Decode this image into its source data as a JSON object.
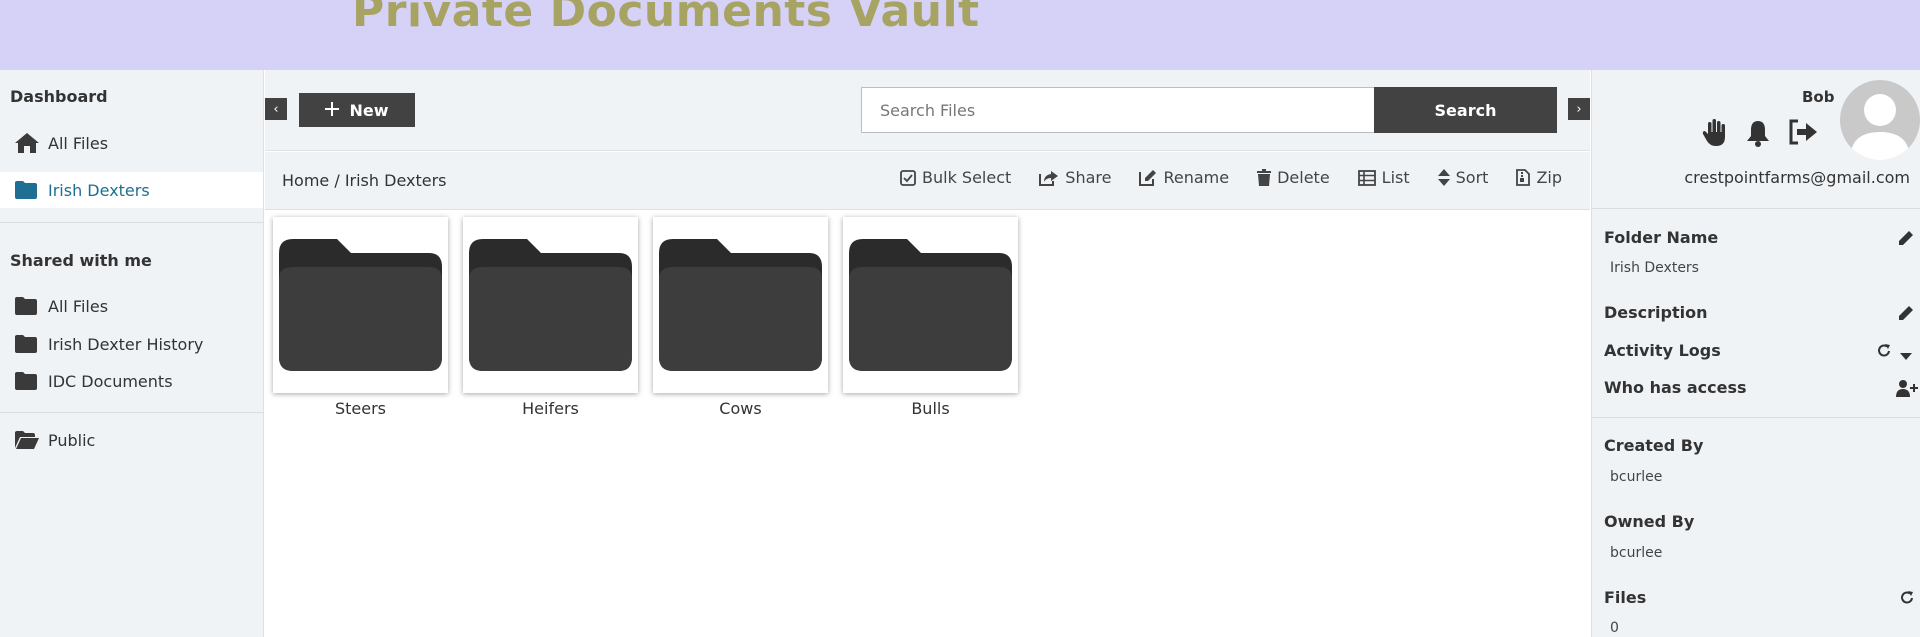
{
  "header": {
    "title": "Private Documents Vault"
  },
  "sidebar": {
    "dashboard_heading": "Dashboard",
    "dashboard_items": [
      {
        "label": "All Files",
        "icon": "home-icon"
      },
      {
        "label": "Irish Dexters",
        "icon": "folder-icon",
        "active": true
      }
    ],
    "shared_heading": "Shared with me",
    "shared_items": [
      {
        "label": "All Files",
        "icon": "folder-icon"
      },
      {
        "label": "Irish Dexter History",
        "icon": "folder-icon"
      },
      {
        "label": "IDC Documents",
        "icon": "folder-icon"
      }
    ],
    "public_item": {
      "label": "Public",
      "icon": "folder-open-icon"
    }
  },
  "toolbar": {
    "collapse_left": "‹",
    "expand_right": "›",
    "new_label": "New",
    "search_placeholder": "Search Files",
    "search_value": "",
    "search_label": "Search"
  },
  "breadcrumb": {
    "text": "Home / Irish Dexters"
  },
  "actions": [
    {
      "label": "Bulk Select",
      "icon": "checkbox-icon"
    },
    {
      "label": "Share",
      "icon": "share-icon"
    },
    {
      "label": "Rename",
      "icon": "edit-icon"
    },
    {
      "label": "Delete",
      "icon": "trash-icon"
    },
    {
      "label": "List",
      "icon": "list-icon"
    },
    {
      "label": "Sort",
      "icon": "sort-icon"
    },
    {
      "label": "Zip",
      "icon": "zip-icon"
    }
  ],
  "folders": [
    {
      "name": "Steers"
    },
    {
      "name": "Heifers"
    },
    {
      "name": "Cows"
    },
    {
      "name": "Bulls"
    }
  ],
  "right_panel": {
    "user_name": "Bob",
    "email": "crestpointfarms@gmail.com",
    "folder_name_label": "Folder Name",
    "folder_name_value": "Irish Dexters",
    "description_label": "Description",
    "activity_logs_label": "Activity Logs",
    "who_has_access_label": "Who has access",
    "created_by_label": "Created By",
    "created_by_value": "bcurlee",
    "owned_by_label": "Owned By",
    "owned_by_value": "bcurlee",
    "files_label": "Files",
    "files_value": "0"
  },
  "colors": {
    "header_bg": "#d6d1f7",
    "title": "#a7a463",
    "button_dark": "#424242",
    "active_link": "#1f6f94",
    "panel_bg": "#f0f3f6"
  }
}
